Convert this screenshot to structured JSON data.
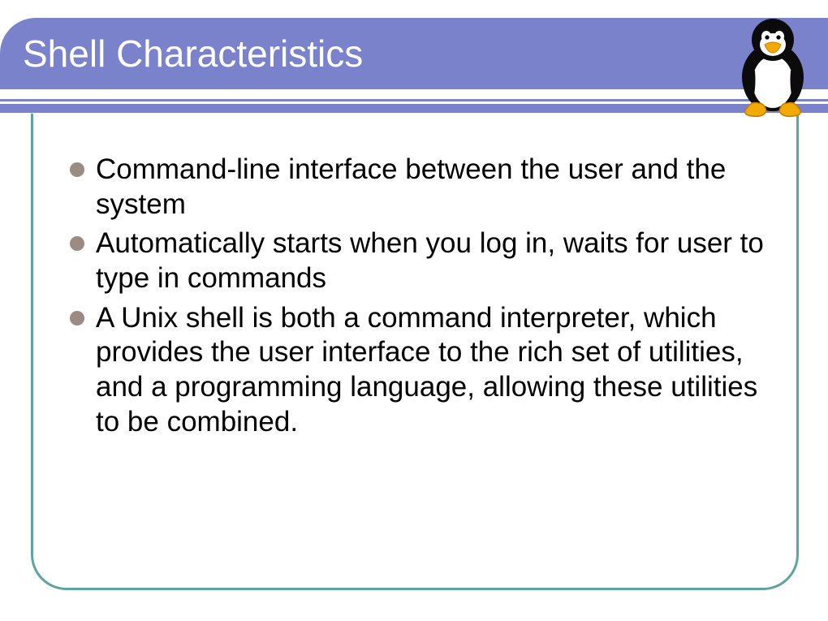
{
  "title": "Shell Characteristics",
  "mascot_name": "tux-penguin",
  "bullets": [
    "Command-line interface between the user and the system",
    "Automatically starts when you log in, waits for user to type in commands",
    "A Unix shell is both a command interpreter, which provides the user interface to the rich set of utilities, and a programming language, allowing these utilities to be combined."
  ]
}
